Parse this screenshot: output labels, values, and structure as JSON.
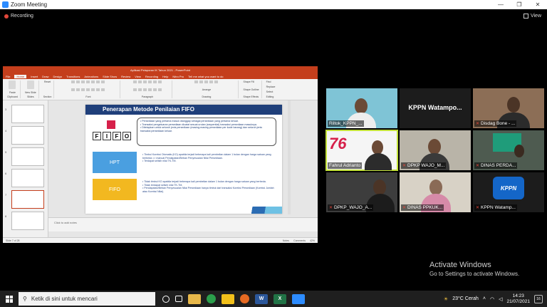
{
  "window": {
    "title": "Zoom Meeting",
    "minimize": "—",
    "maximize": "❐",
    "close": "✕"
  },
  "meeting": {
    "recording_label": "Recording",
    "view_label": "View"
  },
  "ppt": {
    "title": "Aplikasi Pelaporan IK Tahun 2021 - PowerPoint",
    "tabs": [
      "File",
      "Home",
      "Insert",
      "Draw",
      "Design",
      "Transitions",
      "Animations",
      "Slide Show",
      "Review",
      "View",
      "Recording",
      "Help",
      "Nitro Pro",
      "Tell me what you want to do"
    ],
    "groups": [
      "Clipboard",
      "Slides",
      "Font",
      "Paragraph",
      "Drawing",
      "Editing"
    ],
    "buttons": {
      "paste": "Paste",
      "new_slide": "New Slide",
      "reset": "Reset",
      "section": "Section",
      "arrange": "Arrange",
      "quick_styles": "Quick Styles",
      "find": "Find",
      "replace": "Replace",
      "select": "Select",
      "shape_fill": "Shape Fill",
      "shape_outline": "Shape Outline",
      "shape_effects": "Shape Effects"
    },
    "slide": {
      "title": "Penerapan Metode Penilaian FIFO",
      "fifo_letters": [
        "F",
        "I",
        "F",
        "O"
      ],
      "bullets_top": [
        "Persediaan yang pertama masuk dianggap sebagai persediaan yang pertama keluar.",
        "Transaksi pengeluaran persediaan dicatat sesuai urutan (sequential) transaksi persediaan masuknya.",
        "Ditetapkan untuk seluruh jenis persediaan (masing-masing persediaan per kode barang) dan seluruh jenis transaksi persediaan keluar."
      ],
      "hpt_label": "HPT",
      "hpt_bullets": [
        "Timbul Koreksi Otomatis (KO) apabila terjadi beberapa kali pembelian dalam 1 bulan dengan harga satuan yang berbeda => manual Pendapatan/Beban Penyesuaian Nilai Persediaan.",
        "Terdapat selisih nilai TK-TM."
      ],
      "fifo_label": "FIFO",
      "fifo_bullets": [
        "Tidak timbul KO apabila terjadi beberapa kali pembelian dalam 1 bulan dengan harga satuan yang berbeda.",
        "Tidak terdapat selisih nilai TK-TM.",
        "Pendapatan/Beban Penyesuaian Nilai Persediaan hanya timbul dari transaksi Koreksi Persediaan (Koreksi Jumlah atau Koreksi Nilai)."
      ]
    },
    "notes_placeholder": "Click to add notes",
    "status_left": "Slide 7 of 28",
    "status_notes": "Notes",
    "status_comments": "Comments",
    "zoom": "42%",
    "thumb_numbers": [
      "3",
      "4",
      "5",
      "6",
      "7",
      "8"
    ]
  },
  "participants": [
    {
      "name": "Riltok_KPPN_...",
      "muted": false
    },
    {
      "name": "KPPN Watampo...",
      "muted": false,
      "video_off": true
    },
    {
      "name": "Disdag Bone - ...",
      "muted": true
    },
    {
      "name": "Fahrul Adrianto",
      "muted": false,
      "active": true
    },
    {
      "name": "DPKP WAJO_M...",
      "muted": true
    },
    {
      "name": "DINAS PERDA...",
      "muted": true
    },
    {
      "name": "DPKP_WAJO_A...",
      "muted": true
    },
    {
      "name": "DINAS PPKUK...",
      "muted": true
    },
    {
      "name": "KPPN Watamp...",
      "muted": true
    }
  ],
  "tile_logo_text": {
    "seventy_six": "76",
    "kppn": "KPPN"
  },
  "watermark": {
    "line1": "Activate Windows",
    "line2": "Go to Settings to activate Windows."
  },
  "taskbar": {
    "search_placeholder": "Ketik di sini untuk mencari",
    "weather": "23°C  Cerah",
    "time": "14:23",
    "date": "21/07/2021",
    "notifications": "16"
  },
  "colors": {
    "ppt_red": "#c43e1c",
    "slide_navy": "#1f3f7a",
    "hpt_blue": "#4a9fe0",
    "fifo_yellow": "#f2b820",
    "active_speaker": "#c3e23a"
  }
}
